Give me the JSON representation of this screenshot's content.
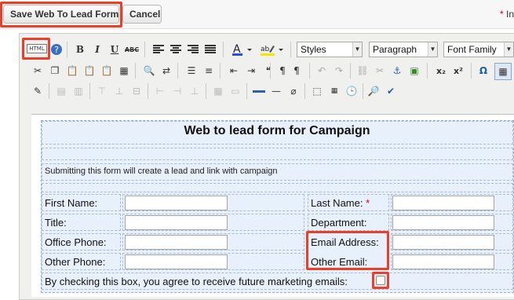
{
  "toolbar_top": {
    "save_label": "Save Web To Lead Form",
    "cancel_label": "Cancel",
    "required_note": "In",
    "required_star": "*"
  },
  "editor": {
    "html_button_label": "HTML",
    "styles_select": "Styles",
    "paragraph_select": "Paragraph",
    "font_family_select": "Font Family"
  },
  "form": {
    "title": "Web to lead form for Campaign",
    "description": "Submitting this form will create a lead and link with campaign",
    "fields": {
      "first_name": "First Name:",
      "last_name": "Last Name:",
      "required_mark": "*",
      "title": "Title:",
      "department": "Department:",
      "office_phone": "Office Phone:",
      "email_address": "Email Address:",
      "other_phone": "Other Phone:",
      "other_email": "Other Email:"
    },
    "opt_in": "By checking this box, you agree to receive future marketing emails:"
  },
  "colors": {
    "highlight": "#e8402a",
    "form_bg": "#e8f0fb",
    "required": "#d0021b"
  }
}
